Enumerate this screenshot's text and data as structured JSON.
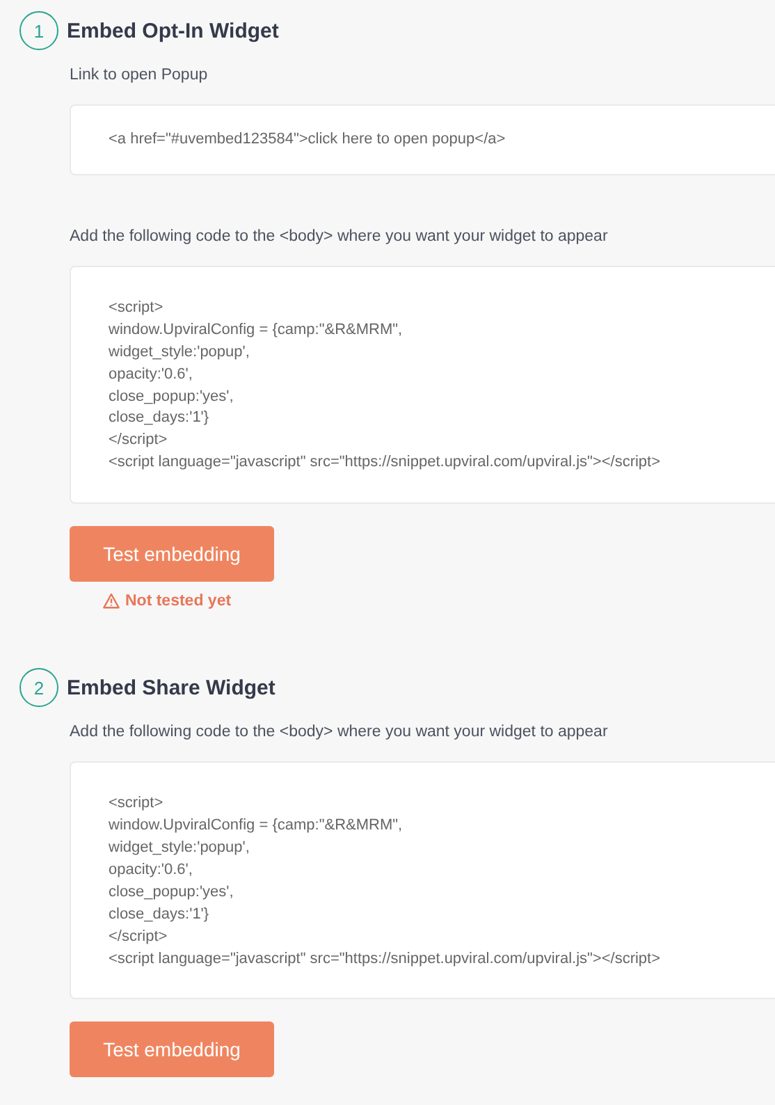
{
  "sections": [
    {
      "number": "1",
      "title": "Embed Opt-In Widget",
      "blocks": [
        {
          "label": "Link to open Popup",
          "code": [
            "<a href=\"#uvembed123584\">click here to open popup</a>"
          ]
        },
        {
          "label": "Add the following code to the <body> where you want your widget to appear",
          "code": [
            "<script>",
            "window.UpviralConfig = {camp:\"&R&MRM\",",
            "widget_style:'popup',",
            "opacity:'0.6',",
            "close_popup:'yes',",
            "close_days:'1'}",
            "</script>",
            "<script language=\"javascript\" src=\"https://snippet.upviral.com/upviral.js\"></script>"
          ]
        }
      ],
      "button": "Test embedding",
      "status": {
        "kind": "warning",
        "text": "Not tested yet"
      }
    },
    {
      "number": "2",
      "title": "Embed Share Widget",
      "blocks": [
        {
          "label": "Add the following code to the <body> where you want your widget to appear",
          "code": [
            "<script>",
            "window.UpviralConfig = {camp:\"&R&MRM\",",
            "widget_style:'popup',",
            "opacity:'0.6',",
            "close_popup:'yes',",
            "close_days:'1'}",
            "</script>",
            "<script language=\"javascript\" src=\"https://snippet.upviral.com/upviral.js\"></script>"
          ]
        }
      ],
      "button": "Test embedding"
    }
  ]
}
